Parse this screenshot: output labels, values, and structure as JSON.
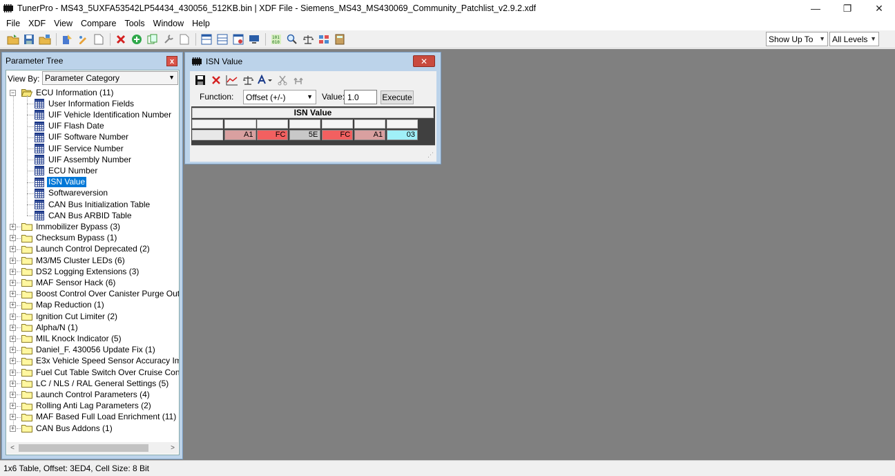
{
  "window": {
    "title": "TunerPro - MS43_5UXFA53542LP54434_430056_512KB.bin | XDF File - Siemens_MS43_MS430069_Community_Patchlist_v2.9.2.xdf",
    "minimize": "—",
    "restore": "❐",
    "close": "✕"
  },
  "menu": [
    "File",
    "XDF",
    "View",
    "Compare",
    "Tools",
    "Window",
    "Help"
  ],
  "toolbar": {
    "show_up_to": "Show Up To",
    "levels": "All Levels"
  },
  "tree": {
    "caption": "Parameter Tree",
    "close": "x",
    "view_by_label": "View By:",
    "view_by_value": "Parameter Category",
    "root": "ECU Information (11)",
    "children": [
      "User Information Fields",
      "UIF Vehicle Identification Number",
      "UIF Flash Date",
      "UIF Software Number",
      "UIF Service Number",
      "UIF Assembly Number",
      "ECU Number",
      "ISN Value",
      "Softwareversion",
      "CAN Bus Initialization Table",
      "CAN Bus ARBID Table"
    ],
    "selected_child": 7,
    "folders": [
      "Immobilizer Bypass (3)",
      "Checksum Bypass (1)",
      "Launch Control Deprecated (2)",
      "M3/M5 Cluster LEDs (6)",
      "DS2 Logging Extensions (3)",
      "MAF Sensor Hack (6)",
      "Boost Control Over Canister Purge Output",
      "Map Reduction (1)",
      "Ignition Cut Limiter (2)",
      "Alpha/N (1)",
      "MIL Knock Indicator (5)",
      "Daniel_F. 430056 Update Fix (1)",
      "E3x Vehicle Speed Sensor Accuracy Improv",
      "Fuel Cut Table Switch Over Cruise Control",
      "LC / NLS / RAL General Settings (5)",
      "Launch Control Parameters (4)",
      "Rolling Anti Lag Parameters (2)",
      "MAF Based Full Load Enrichment (11)",
      "CAN Bus Addons (1)"
    ]
  },
  "isn_window": {
    "caption": "ISN Value",
    "close": "✕",
    "function_label": "Function:",
    "function_value": "Offset (+/-)",
    "value_label": "Value:",
    "value": "1.0",
    "execute": "Execute",
    "table_title": "ISN Value",
    "cells": [
      {
        "value": "A1",
        "color": "#d9a0a0"
      },
      {
        "value": "FC",
        "color": "#f26060"
      },
      {
        "value": "5E",
        "color": "#c8c8c8"
      },
      {
        "value": "FC",
        "color": "#f26060"
      },
      {
        "value": "A1",
        "color": "#d9a0a0"
      },
      {
        "value": "03",
        "color": "#a0f0f8"
      }
    ]
  },
  "status": "1x6 Table, Offset: 3ED4,  Cell Size: 8 Bit"
}
